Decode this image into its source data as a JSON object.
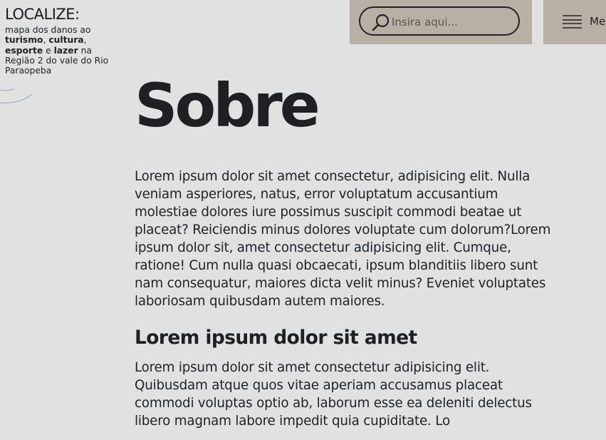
{
  "brand": {
    "title": "LOCALIZE:",
    "subtitle_parts": [
      "mapa dos danos ao ",
      "turismo",
      ", ",
      "cultura",
      ", ",
      "esporte",
      " e ",
      "lazer",
      " na Região 2 do vale do Rio Paraopeba"
    ]
  },
  "search": {
    "placeholder": "Insira aqui..."
  },
  "menu": {
    "label": "Menu"
  },
  "main": {
    "title": "Sobre",
    "paragraph1": "Lorem ipsum dolor sit amet consectetur, adipisicing elit. Nulla veniam asperiores, natus, error voluptatum accusantium molestiae dolores iure possimus suscipit commodi beatae ut placeat? Reiciendis minus dolores voluptate cum dolorum?Lorem ipsum dolor sit, amet consectetur adipisicing elit. Cumque, ratione! Cum nulla quasi obcaecati, ipsum blanditiis libero sunt nam consequatur, maiores dicta velit minus? Eveniet voluptates laboriosam quibusdam autem maiores.",
    "heading": "Lorem ipsum dolor sit amet",
    "paragraph2": "Lorem ipsum dolor sit amet consectetur adipisicing elit. Quibusdam atque quos vitae aperiam accusamus placeat commodi voluptas optio ab, laborum esse ea deleniti delectus libero magnam labore impedit quia cupiditate. Lo"
  },
  "colors": {
    "background": "#e1e1e1",
    "panel": "#b8afa5",
    "text": "#1f2124",
    "accent_line": "#8fa3b8"
  }
}
